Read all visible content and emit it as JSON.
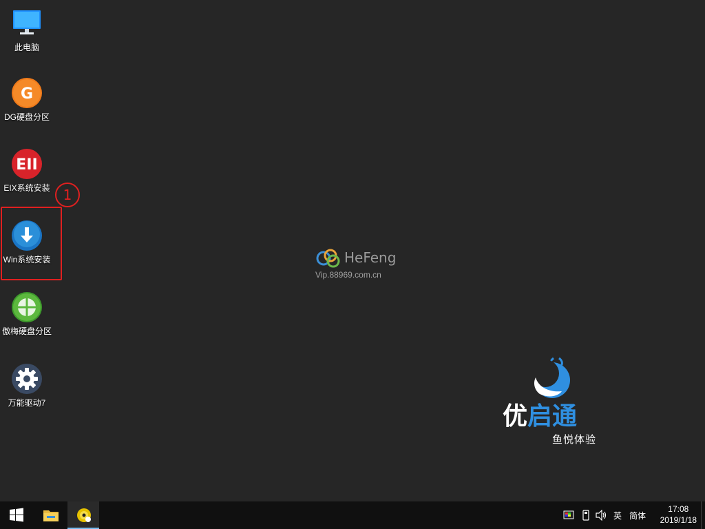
{
  "desktop": {
    "icons": [
      {
        "label": "此电脑",
        "icon": "computer-icon"
      },
      {
        "label": "DG硬盘分区",
        "icon": "dg-partition-icon"
      },
      {
        "label": "EIX系统安装",
        "icon": "eix-install-icon"
      },
      {
        "label": "Win系统安装",
        "icon": "win-install-icon"
      },
      {
        "label": "傲梅硬盘分区",
        "icon": "aomei-partition-icon"
      },
      {
        "label": "万能驱动7",
        "icon": "gear-icon"
      }
    ],
    "annotation_number": "1"
  },
  "watermark": {
    "brand": "HeFeng",
    "url": "Vip.88969.com.cn"
  },
  "brand": {
    "name_part1": "优",
    "name_part2": "启通",
    "subtitle": "鱼悦体验",
    "accent_color": "#2f8fe0"
  },
  "taskbar": {
    "start": "windows-start-icon",
    "apps": [
      "file-explorer-icon",
      "disc-tool-icon"
    ],
    "tray": {
      "language": "英",
      "ime_mode": "简体"
    },
    "clock": {
      "time": "17:08",
      "date": "2019/1/18"
    }
  }
}
